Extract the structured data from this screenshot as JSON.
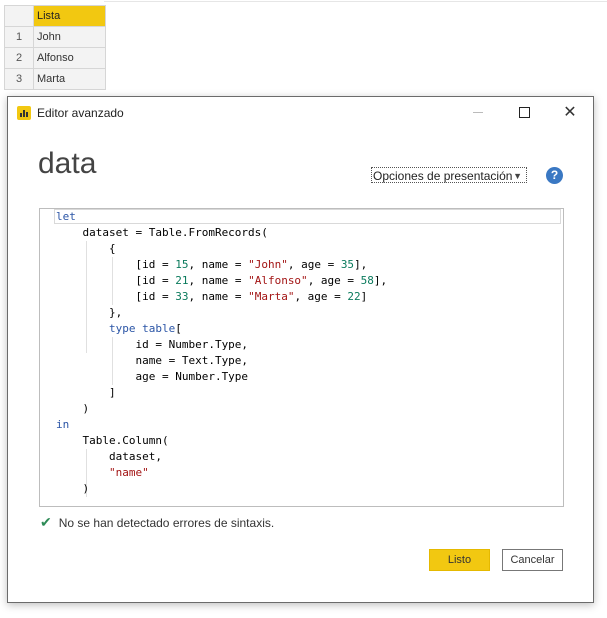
{
  "background_table": {
    "column_header": "Lista",
    "rows": [
      {
        "index": "1",
        "value": "John"
      },
      {
        "index": "2",
        "value": "Alfonso"
      },
      {
        "index": "3",
        "value": "Marta"
      }
    ]
  },
  "dialog": {
    "title": "Editor avanzado",
    "window_buttons": {
      "minimize": "—",
      "maximize": "☐",
      "close": "✕"
    },
    "query_name": "data",
    "display_options": "Opciones de presentación",
    "help_label": "?",
    "code_lines": [
      [
        {
          "t": "let",
          "c": "kw"
        }
      ],
      [
        {
          "t": "    dataset = Table.FromRecords(",
          "c": ""
        }
      ],
      [
        {
          "t": "        {",
          "c": ""
        }
      ],
      [
        {
          "t": "            [id = ",
          "c": ""
        },
        {
          "t": "15",
          "c": "num"
        },
        {
          "t": ", name = ",
          "c": ""
        },
        {
          "t": "\"John\"",
          "c": "str"
        },
        {
          "t": ", age = ",
          "c": ""
        },
        {
          "t": "35",
          "c": "num"
        },
        {
          "t": "],",
          "c": ""
        }
      ],
      [
        {
          "t": "            [id = ",
          "c": ""
        },
        {
          "t": "21",
          "c": "num"
        },
        {
          "t": ", name = ",
          "c": ""
        },
        {
          "t": "\"Alfonso\"",
          "c": "str"
        },
        {
          "t": ", age = ",
          "c": ""
        },
        {
          "t": "58",
          "c": "num"
        },
        {
          "t": "],",
          "c": ""
        }
      ],
      [
        {
          "t": "            [id = ",
          "c": ""
        },
        {
          "t": "33",
          "c": "num"
        },
        {
          "t": ", name = ",
          "c": ""
        },
        {
          "t": "\"Marta\"",
          "c": "str"
        },
        {
          "t": ", age = ",
          "c": ""
        },
        {
          "t": "22",
          "c": "num"
        },
        {
          "t": "]",
          "c": ""
        }
      ],
      [
        {
          "t": "        },",
          "c": ""
        }
      ],
      [
        {
          "t": "        ",
          "c": ""
        },
        {
          "t": "type table",
          "c": "kw"
        },
        {
          "t": "[",
          "c": ""
        }
      ],
      [
        {
          "t": "            id = Number.Type,",
          "c": ""
        }
      ],
      [
        {
          "t": "            name = Text.Type,",
          "c": ""
        }
      ],
      [
        {
          "t": "            age = Number.Type",
          "c": ""
        }
      ],
      [
        {
          "t": "        ]",
          "c": ""
        }
      ],
      [
        {
          "t": "    )",
          "c": ""
        }
      ],
      [
        {
          "t": "in",
          "c": "kw"
        }
      ],
      [
        {
          "t": "    Table.Column(",
          "c": ""
        }
      ],
      [
        {
          "t": "        dataset,",
          "c": ""
        }
      ],
      [
        {
          "t": "        ",
          "c": ""
        },
        {
          "t": "\"name\"",
          "c": "str"
        }
      ],
      [
        {
          "t": "    )",
          "c": ""
        }
      ]
    ],
    "status_text": "No se han detectado errores de sintaxis.",
    "ok_label": "Listo",
    "cancel_label": "Cancelar",
    "colors": {
      "accent": "#f2c811",
      "keyword": "#2b55a6",
      "string": "#a31515",
      "number": "#0a7a5c",
      "success": "#2e8b57"
    }
  }
}
